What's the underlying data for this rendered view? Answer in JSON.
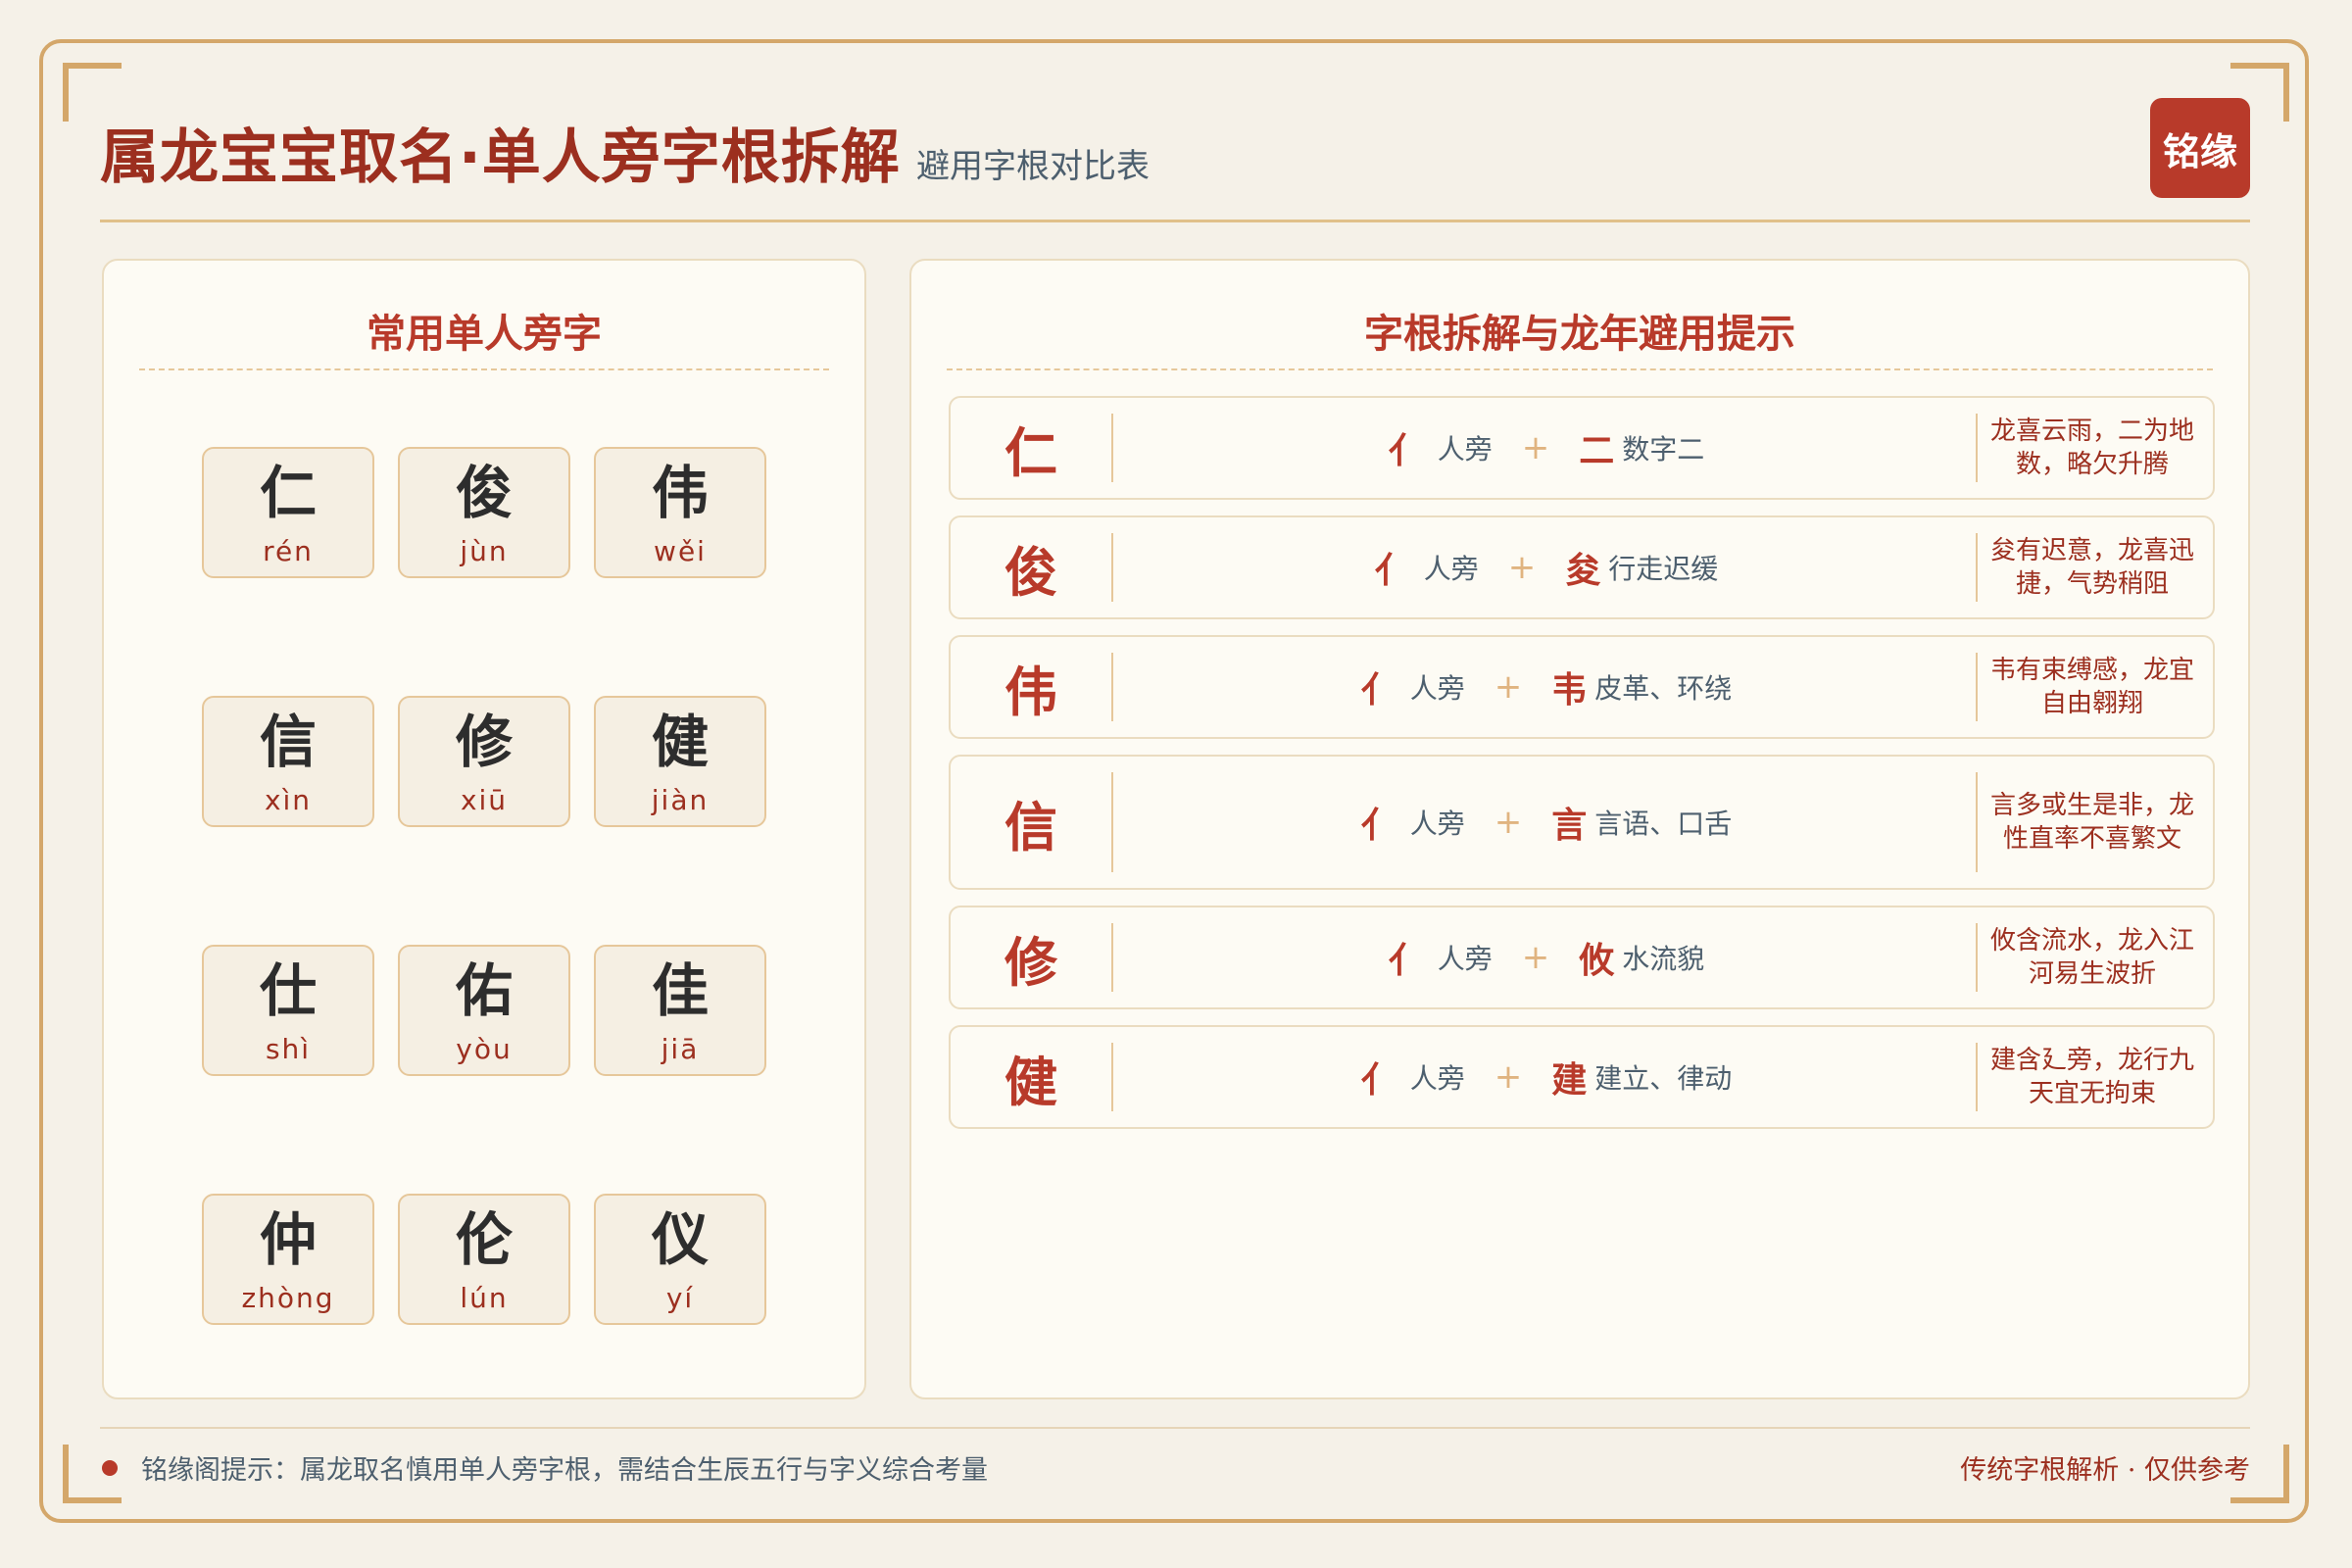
{
  "header": {
    "title": "属龙宝宝取名·单人旁字根拆解",
    "subtitle": "避用字根对比表",
    "seal": "铭缘"
  },
  "left_panel": {
    "title": "常用单人旁字",
    "chars": [
      {
        "char": "仁",
        "pinyin": "rén"
      },
      {
        "char": "俊",
        "pinyin": "jùn"
      },
      {
        "char": "伟",
        "pinyin": "wěi"
      },
      {
        "char": "信",
        "pinyin": "xìn"
      },
      {
        "char": "修",
        "pinyin": "xiū"
      },
      {
        "char": "健",
        "pinyin": "jiàn"
      },
      {
        "char": "仕",
        "pinyin": "shì"
      },
      {
        "char": "佑",
        "pinyin": "yòu"
      },
      {
        "char": "佳",
        "pinyin": "jiā"
      },
      {
        "char": "仲",
        "pinyin": "zhòng"
      },
      {
        "char": "伦",
        "pinyin": "lún"
      },
      {
        "char": "仪",
        "pinyin": "yí"
      }
    ]
  },
  "right_panel": {
    "title": "字根拆解与龙年避用提示",
    "rows": [
      {
        "char": "仁",
        "radical1": "亻",
        "meaning1": "人旁",
        "plus": "+",
        "radical2": "二",
        "meaning2": "数字二",
        "tip": "龙喜云雨，二为地数，略欠升腾"
      },
      {
        "char": "俊",
        "radical1": "亻",
        "meaning1": "人旁",
        "plus": "+",
        "radical2": "夋",
        "meaning2": "行走迟缓",
        "tip": "夋有迟意，龙喜迅捷，气势稍阻"
      },
      {
        "char": "伟",
        "radical1": "亻",
        "meaning1": "人旁",
        "plus": "+",
        "radical2": "韦",
        "meaning2": "皮革、环绕",
        "tip": "韦有束缚感，龙宜自由翱翔"
      },
      {
        "char": "信",
        "radical1": "亻",
        "meaning1": "人旁",
        "plus": "+",
        "radical2": "言",
        "meaning2": "言语、口舌",
        "tip": "言多或生是非，龙性直率不喜繁文"
      },
      {
        "char": "修",
        "radical1": "亻",
        "meaning1": "人旁",
        "plus": "+",
        "radical2": "攸",
        "meaning2": "水流貌",
        "tip": "攸含流水，龙入江河易生波折"
      },
      {
        "char": "健",
        "radical1": "亻",
        "meaning1": "人旁",
        "plus": "+",
        "radical2": "建",
        "meaning2": "建立、律动",
        "tip": "建含廴旁，龙行九天宜无拘束"
      }
    ]
  },
  "footer": {
    "left": "铭缘阁提示：属龙取名慎用单人旁字根，需结合生辰五行与字义综合考量",
    "right": "传统字根解析 · 仅供参考"
  },
  "colors": {
    "primary_red": "#b83a2a",
    "title_red": "#9c2f1f",
    "gold": "#d4a76a",
    "background": "#f5f1e8",
    "text_slate": "#4d5f6e"
  }
}
